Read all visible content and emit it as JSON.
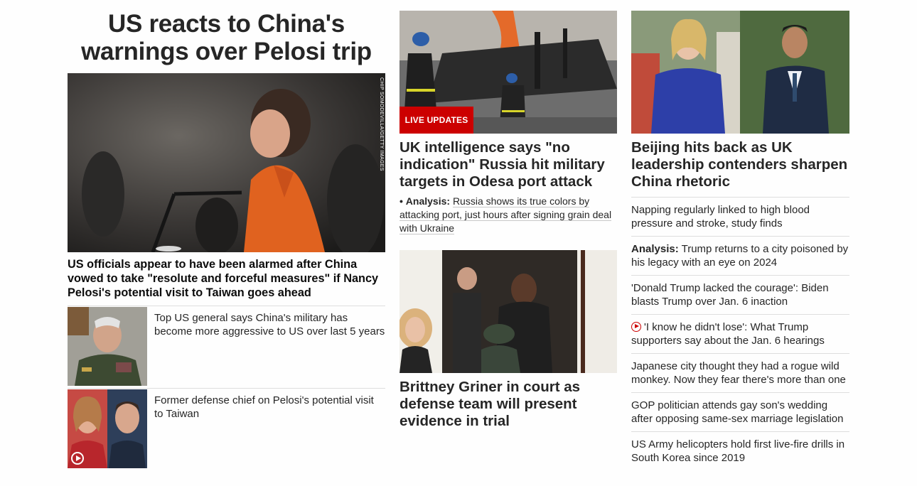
{
  "col1": {
    "headline": "US reacts to China's warnings over Pelosi trip",
    "photo_credit": "Chip Somodevilla/Getty Images",
    "hero_caption": "US officials appear to have been alarmed after China vowed to take \"resolute and forceful measures\" if Nancy Pelosi's potential visit to Taiwan goes ahead",
    "related": [
      {
        "text": "Top US general says China's military has become more aggressive to US over last 5 years"
      },
      {
        "text": "Former defense chief on Pelosi's potential visit to Taiwan",
        "video": true
      }
    ]
  },
  "col2": {
    "live_badge": "LIVE UPDATES",
    "headline1": "UK intelligence says \"no indication\" Russia hit military targets in Odesa port attack",
    "analysis_bullet": "•",
    "analysis_tag": "Analysis:",
    "analysis_text": "Russia shows its true colors by attacking port, just hours after signing grain deal with Ukraine",
    "headline2": "Brittney Griner in court as defense team will present evidence in trial"
  },
  "col3": {
    "headline": "Beijing hits back as UK leadership contenders sharpen China rhetoric",
    "list": [
      {
        "text": "Napping regularly linked to high blood pressure and stroke, study finds"
      },
      {
        "tag": "Analysis:",
        "text": "Trump returns to a city poisoned by his legacy with an eye on 2024"
      },
      {
        "text": "'Donald Trump lacked the courage': Biden blasts Trump over Jan. 6 inaction"
      },
      {
        "text": "'I know he didn't lose': What Trump supporters say about the Jan. 6 hearings",
        "video": true
      },
      {
        "text": "Japanese city thought they had a rogue wild monkey. Now they fear there's more than one"
      },
      {
        "text": "GOP politician attends gay son's wedding after opposing same-sex marriage legislation"
      },
      {
        "text": "US Army helicopters hold first live-fire drills in South Korea since 2019"
      }
    ]
  },
  "colors": {
    "accent_red": "#cc0000",
    "text": "#262626",
    "divider": "#dedede"
  },
  "icons": [
    "play-icon"
  ]
}
